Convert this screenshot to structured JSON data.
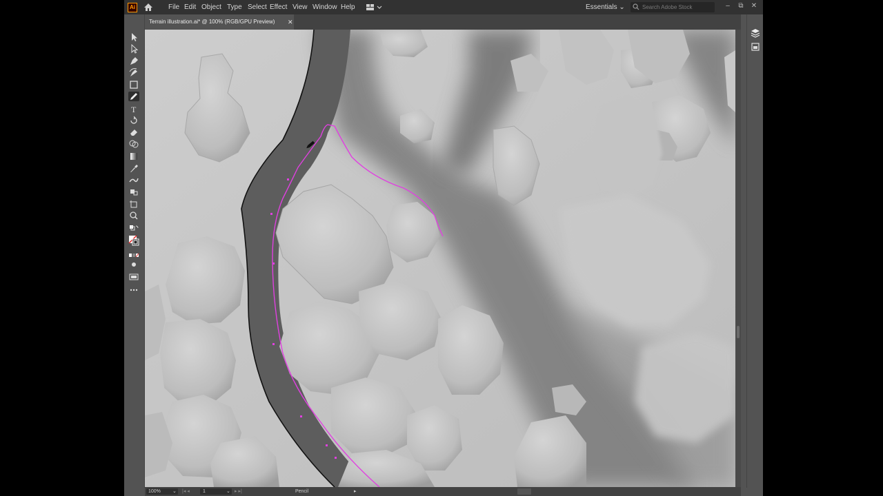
{
  "app": {
    "logo": "Ai",
    "home_icon": "home-icon"
  },
  "menu": [
    "File",
    "Edit",
    "Object",
    "Type",
    "Select",
    "Effect",
    "View",
    "Window",
    "Help"
  ],
  "topbar": {
    "workspace": "Essentials",
    "search_placeholder": "Search Adobe Stock"
  },
  "window_controls": {
    "minimize": "–",
    "restore": "⧉",
    "close": "✕"
  },
  "document_tab": {
    "title": "Terrain illustration.ai* @ 100% (RGB/GPU Preview)",
    "close": "✕"
  },
  "tools": [
    {
      "name": "selection-tool",
      "icon": "arrow-icon"
    },
    {
      "name": "direct-selection-tool",
      "icon": "white-arrow-icon"
    },
    {
      "name": "pen-tool",
      "icon": "pen-icon"
    },
    {
      "name": "curvature-tool",
      "icon": "curvature-icon"
    },
    {
      "name": "rectangle-tool",
      "icon": "rectangle-icon"
    },
    {
      "name": "pencil-tool",
      "icon": "pencil-icon",
      "active": true
    },
    {
      "name": "type-tool",
      "icon": "type-icon"
    },
    {
      "name": "rotate-tool",
      "icon": "rotate-icon"
    },
    {
      "name": "eraser-tool",
      "icon": "eraser-icon"
    },
    {
      "name": "shape-builder-tool",
      "icon": "shape-builder-icon"
    },
    {
      "name": "gradient-tool",
      "icon": "gradient-icon"
    },
    {
      "name": "eyedropper-tool",
      "icon": "eyedropper-icon"
    },
    {
      "name": "puppet-warp-tool",
      "icon": "puppet-warp-icon"
    },
    {
      "name": "symbol-sprayer-tool",
      "icon": "symbol-icon"
    },
    {
      "name": "artboard-tool",
      "icon": "artboard-icon"
    },
    {
      "name": "zoom-tool",
      "icon": "zoom-icon"
    }
  ],
  "status": {
    "zoom": "100%",
    "artboard": "1",
    "tool": "Pencil"
  },
  "colors": {
    "app_bg": "#535353",
    "menubar": "#323232",
    "canvas": "#c7c7c7",
    "path_highlight": "#e040e0",
    "river": "#5a5a5a"
  }
}
